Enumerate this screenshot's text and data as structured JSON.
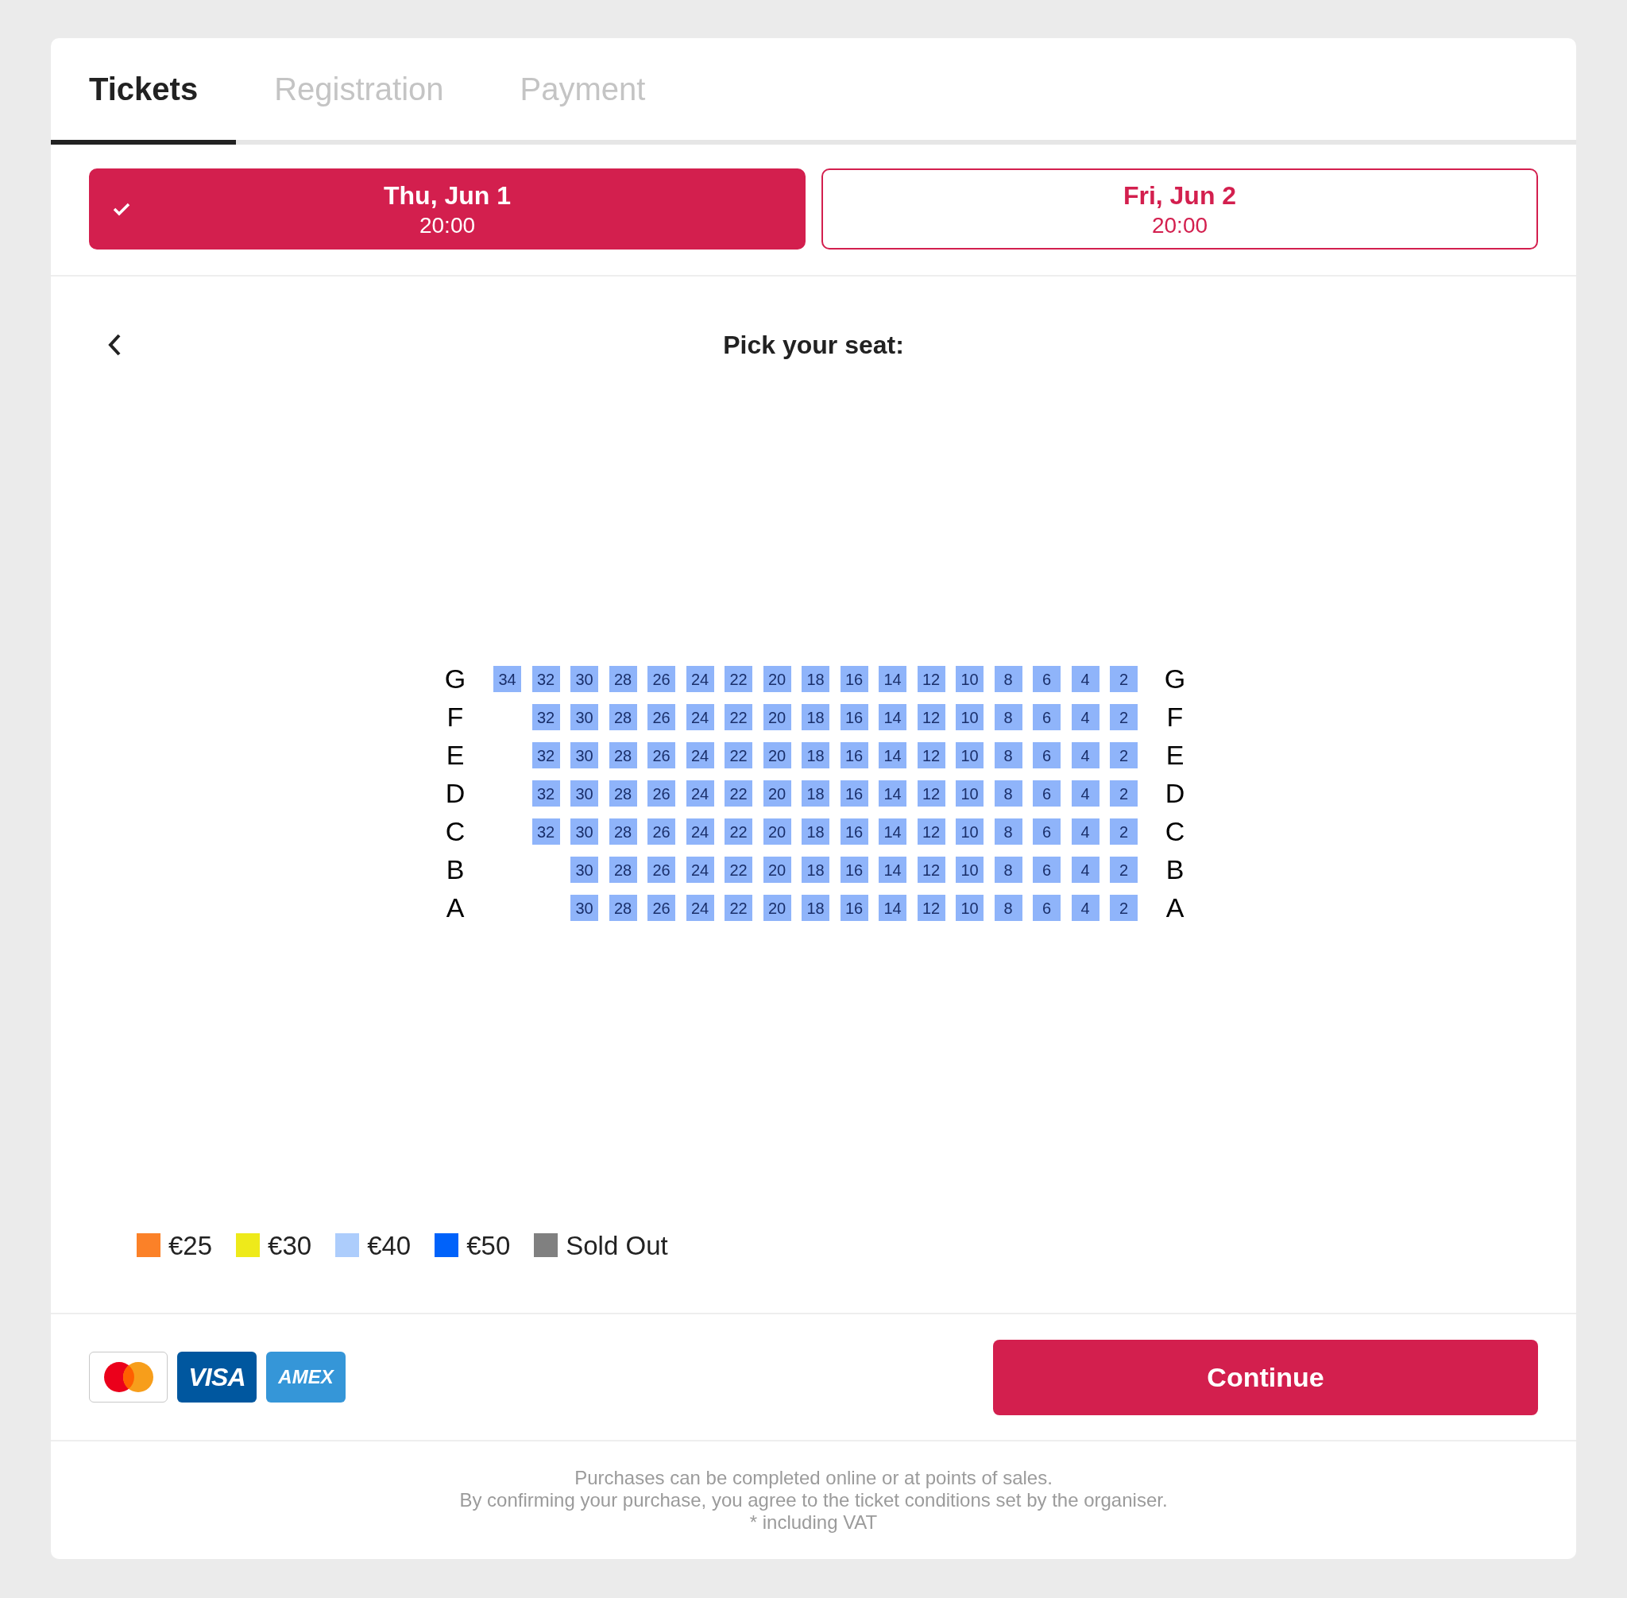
{
  "tabs": [
    {
      "label": "Tickets",
      "selected": true
    },
    {
      "label": "Registration",
      "selected": false
    },
    {
      "label": "Payment",
      "selected": false
    }
  ],
  "dates": [
    {
      "day": "Thu, Jun 1",
      "time": "20:00",
      "selected": true
    },
    {
      "day": "Fri, Jun 2",
      "time": "20:00",
      "selected": false
    }
  ],
  "seat_picker": {
    "title": "Pick your seat:",
    "rows": [
      {
        "label_left": "G",
        "label_right": "G",
        "seats": [
          "34",
          "32",
          "30",
          "28",
          "26",
          "24",
          "22",
          "20",
          "18",
          "16",
          "14",
          "12",
          "10",
          "8",
          "6",
          "4",
          "2"
        ]
      },
      {
        "label_left": "F",
        "label_right": "F",
        "seats": [
          "32",
          "30",
          "28",
          "26",
          "24",
          "22",
          "20",
          "18",
          "16",
          "14",
          "12",
          "10",
          "8",
          "6",
          "4",
          "2"
        ]
      },
      {
        "label_left": "E",
        "label_right": "E",
        "seats": [
          "32",
          "30",
          "28",
          "26",
          "24",
          "22",
          "20",
          "18",
          "16",
          "14",
          "12",
          "10",
          "8",
          "6",
          "4",
          "2"
        ]
      },
      {
        "label_left": "D",
        "label_right": "D",
        "seats": [
          "32",
          "30",
          "28",
          "26",
          "24",
          "22",
          "20",
          "18",
          "16",
          "14",
          "12",
          "10",
          "8",
          "6",
          "4",
          "2"
        ]
      },
      {
        "label_left": "C",
        "label_right": "C",
        "seats": [
          "32",
          "30",
          "28",
          "26",
          "24",
          "22",
          "20",
          "18",
          "16",
          "14",
          "12",
          "10",
          "8",
          "6",
          "4",
          "2"
        ]
      },
      {
        "label_left": "B",
        "label_right": "B",
        "seats": [
          "30",
          "28",
          "26",
          "24",
          "22",
          "20",
          "18",
          "16",
          "14",
          "12",
          "10",
          "8",
          "6",
          "4",
          "2"
        ]
      },
      {
        "label_left": "A",
        "label_right": "A",
        "seats": [
          "30",
          "28",
          "26",
          "24",
          "22",
          "20",
          "18",
          "16",
          "14",
          "12",
          "10",
          "8",
          "6",
          "4",
          "2"
        ]
      }
    ],
    "legend": [
      {
        "label": "€25",
        "color": "#fb8128"
      },
      {
        "label": "€30",
        "color": "#eeea1a"
      },
      {
        "label": "€40",
        "color": "#adcdfc"
      },
      {
        "label": "€50",
        "color": "#0062fa"
      },
      {
        "label": "Sold Out",
        "color": "#808080"
      }
    ]
  },
  "payment_methods": [
    {
      "kind": "mastercard"
    },
    {
      "kind": "visa",
      "label": "VISA"
    },
    {
      "kind": "amex",
      "label": "AMEX"
    }
  ],
  "continue_button": "Continue",
  "footer": [
    "Purchases can be completed online or at points of sales.",
    "By confirming your purchase, you agree to the ticket conditions set by the organiser.",
    "* including VAT"
  ]
}
